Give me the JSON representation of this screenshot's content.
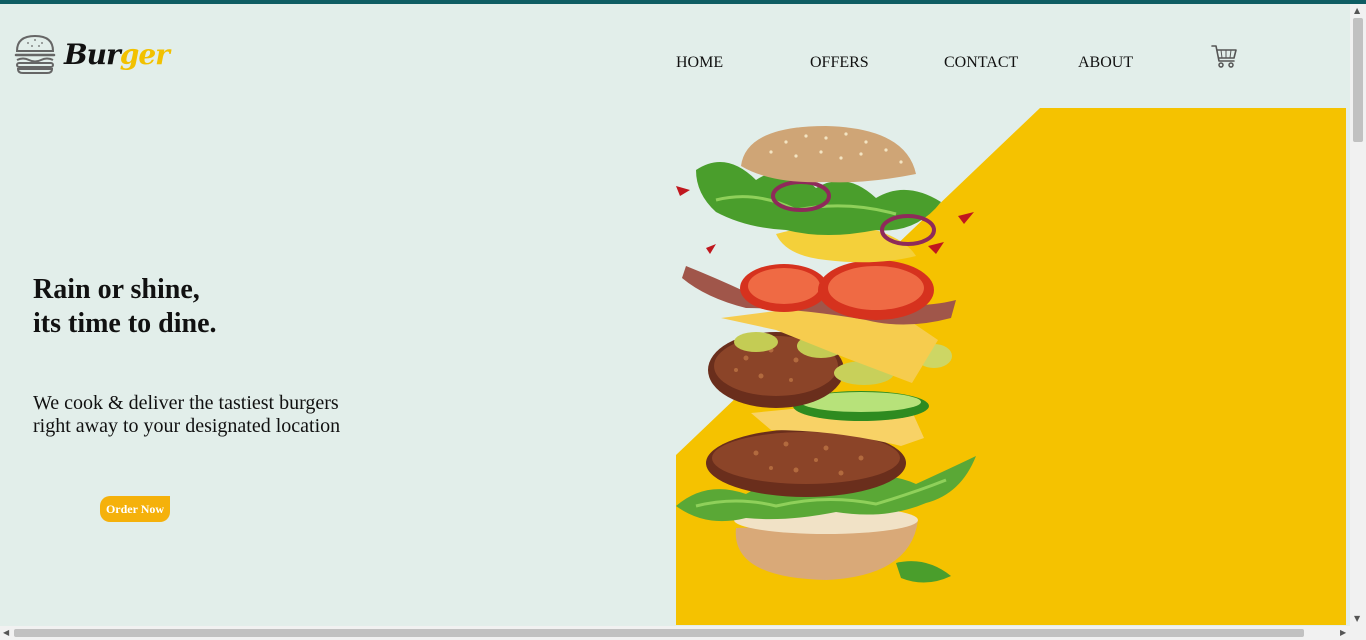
{
  "brand": {
    "name_part1": "Bur",
    "name_part2": "ger",
    "logo_icon": "burger-icon",
    "accent_color": "#f2c100"
  },
  "nav": {
    "items": [
      {
        "label": "HOME"
      },
      {
        "label": "OFFERS"
      },
      {
        "label": "CONTACT"
      },
      {
        "label": "ABOUT"
      }
    ],
    "cart_icon": "cart-icon"
  },
  "hero": {
    "title_line1": "Rain or shine,",
    "title_line2": "its time to dine.",
    "subtitle_line1": "We cook & deliver the tastiest burgers",
    "subtitle_line2": "right away to your designated location",
    "cta_label": "Order Now",
    "cta_color": "#f5b10b",
    "panel_color": "#f5c200",
    "background_color": "#e2eeea"
  }
}
